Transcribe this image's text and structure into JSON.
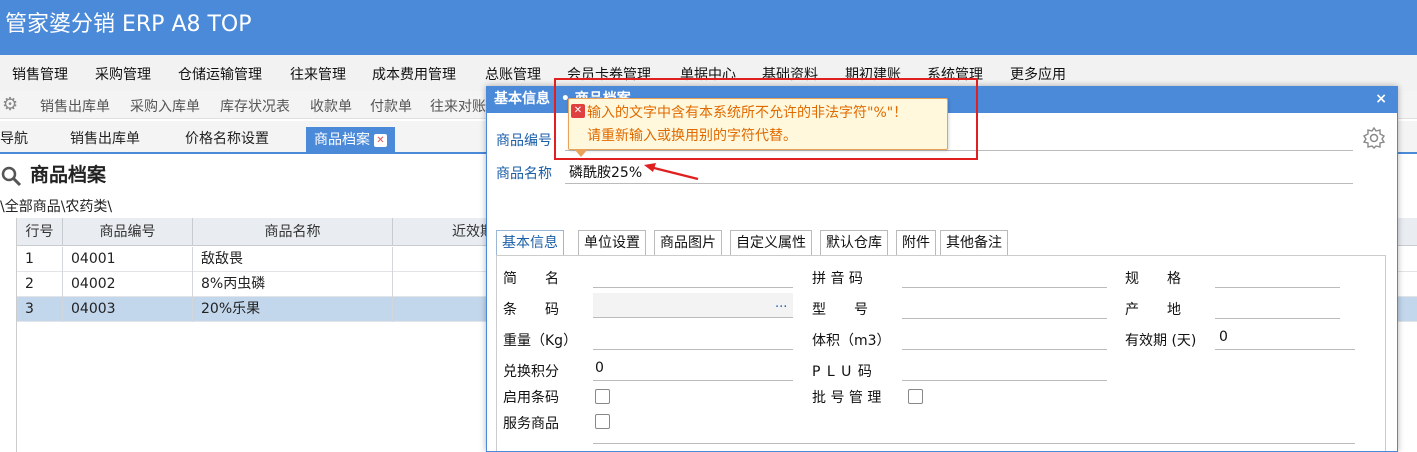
{
  "app": {
    "title": "管家婆分销 ERP A8 TOP"
  },
  "menu": [
    "销售管理",
    "采购管理",
    "仓储运输管理",
    "往来管理",
    "成本费用管理",
    "总账管理",
    "会员卡券管理",
    "单据中心",
    "基础资料",
    "期初建账",
    "系统管理",
    "更多应用"
  ],
  "toolbar": [
    "销售出库单",
    "采购入库单",
    "库存状况表",
    "收款单",
    "付款单",
    "往来对账"
  ],
  "tabs": [
    {
      "label": "导航"
    },
    {
      "label": "销售出库单"
    },
    {
      "label": "价格名称设置"
    },
    {
      "label": "商品档案",
      "active": true
    }
  ],
  "page": {
    "title": "商品档案",
    "breadcrumb": "\\全部商品\\农药类\\"
  },
  "grid": {
    "columns": [
      "行号",
      "商品编号",
      "商品名称",
      "近效期"
    ],
    "rows": [
      {
        "no": "1",
        "code": "04001",
        "name": "敌敌畏"
      },
      {
        "no": "2",
        "code": "04002",
        "name": "8%丙虫磷"
      },
      {
        "no": "3",
        "code": "04003",
        "name": "20%乐果",
        "selected": true
      }
    ]
  },
  "dialog": {
    "title": "基本信息",
    "subtitle": "商品档案",
    "close": "×",
    "code_label": "商品编号",
    "name_label": "商品名称",
    "name_value": "磷酰胺25%",
    "tabs": [
      "基本信息",
      "单位设置",
      "商品图片",
      "自定义属性",
      "默认仓库",
      "附件",
      "其他备注"
    ],
    "fields": {
      "jianming": "简　　名",
      "pinyin": "拼 音 码",
      "guige": "规　　格",
      "tiaoma": "条　　码",
      "xinghao": "型　　号",
      "chandi": "产　　地",
      "zhongliang": "重量（Kg）",
      "tiji": "体积（m3）",
      "youxiaoqi": "有效期 (天)",
      "youxiaoqi_value": "0",
      "jifen": "兑换积分",
      "jifen_value": "0",
      "plu": "P L U 码",
      "qiyong": "启用条码",
      "pihao": "批 号 管 理",
      "fuwu": "服务商品",
      "dots": "···"
    }
  },
  "error_tip": {
    "line1": "输入的文字中含有本系统所不允许的非法字符\"%\"！",
    "line2": "请重新输入或换用别的字符代替。"
  },
  "colors": {
    "titlebar": "#4a8ad9",
    "annotation_red": "#e02020",
    "error_text": "#e06a00",
    "label_blue": "#1a5ea8"
  }
}
